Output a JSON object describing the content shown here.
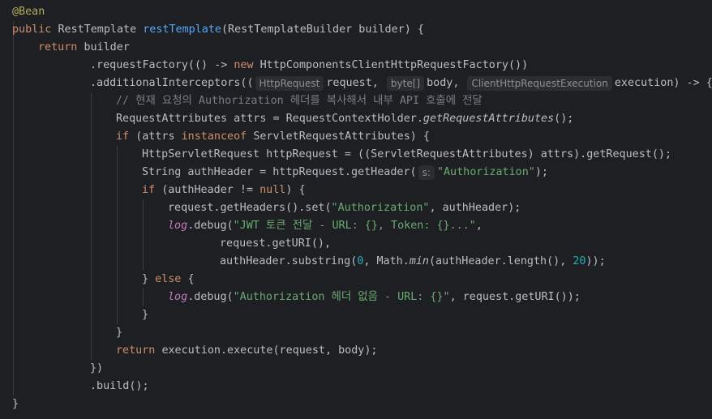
{
  "editor": {
    "language": "java",
    "inlay_hints": [
      "HttpRequest",
      "byte[]",
      "ClientHttpRequestExecution",
      "s:"
    ],
    "colors": {
      "background": "#1e1f22",
      "default": "#bcbec4",
      "keyword": "#cf8e6d",
      "annotation": "#b3ae60",
      "method_declaration": "#56a8f5",
      "string": "#6aab73",
      "number": "#2aacb8",
      "comment": "#7a7e85",
      "static_field": "#c77dbb",
      "inlay_hint_bg": "#2b2d30",
      "inlay_hint_text": "#8c8f94"
    },
    "lines": [
      {
        "indent": 0,
        "tokens": [
          {
            "t": "@Bean",
            "c": "ann"
          }
        ]
      },
      {
        "indent": 0,
        "tokens": [
          {
            "t": "public ",
            "c": "kw"
          },
          {
            "t": "RestTemplate ",
            "c": "def"
          },
          {
            "t": "restTemplate",
            "c": "fn"
          },
          {
            "t": "(RestTemplateBuilder builder) {",
            "c": "def"
          }
        ]
      },
      {
        "indent": 1,
        "tokens": [
          {
            "t": "return ",
            "c": "kw"
          },
          {
            "t": "builder",
            "c": "def"
          }
        ]
      },
      {
        "indent": 3,
        "tokens": [
          {
            "t": ".requestFactory(() -> ",
            "c": "def"
          },
          {
            "t": "new ",
            "c": "kw"
          },
          {
            "t": "HttpComponentsClientHttpRequestFactory())",
            "c": "def"
          }
        ]
      },
      {
        "indent": 3,
        "tokens": [
          {
            "t": ".additionalInterceptors((",
            "c": "def"
          },
          {
            "t": "HttpRequest",
            "c": "hint"
          },
          {
            "t": "request, ",
            "c": "def"
          },
          {
            "t": "byte[]",
            "c": "hint"
          },
          {
            "t": "body, ",
            "c": "def"
          },
          {
            "t": "ClientHttpRequestExecution",
            "c": "hint"
          },
          {
            "t": "execution) -> {",
            "c": "def"
          }
        ]
      },
      {
        "indent": 4,
        "tokens": [
          {
            "t": "// 현재 요청의 Authorization 헤더를 복사해서 내부 API 호출에 전달",
            "c": "cmt"
          }
        ]
      },
      {
        "indent": 4,
        "tokens": [
          {
            "t": "RequestAttributes attrs = RequestContextHolder.",
            "c": "def"
          },
          {
            "t": "getRequestAttributes",
            "c": "def ital"
          },
          {
            "t": "();",
            "c": "def"
          }
        ]
      },
      {
        "indent": 4,
        "tokens": [
          {
            "t": "if ",
            "c": "kw"
          },
          {
            "t": "(attrs ",
            "c": "def"
          },
          {
            "t": "instanceof ",
            "c": "kw"
          },
          {
            "t": "ServletRequestAttributes) {",
            "c": "def"
          }
        ]
      },
      {
        "indent": 5,
        "tokens": [
          {
            "t": "HttpServletRequest httpRequest = ((ServletRequestAttributes) attrs).getRequest();",
            "c": "def"
          }
        ]
      },
      {
        "indent": 5,
        "tokens": [
          {
            "t": "String authHeader = httpRequest.getHeader(",
            "c": "def"
          },
          {
            "t": "s:",
            "c": "hint"
          },
          {
            "t": "\"Authorization\"",
            "c": "str"
          },
          {
            "t": ");",
            "c": "def"
          }
        ]
      },
      {
        "indent": 5,
        "tokens": [
          {
            "t": "if ",
            "c": "kw"
          },
          {
            "t": "(authHeader != ",
            "c": "def"
          },
          {
            "t": "null",
            "c": "kw"
          },
          {
            "t": ") {",
            "c": "def"
          }
        ]
      },
      {
        "indent": 6,
        "tokens": [
          {
            "t": "request.getHeaders().set(",
            "c": "def"
          },
          {
            "t": "\"Authorization\"",
            "c": "str"
          },
          {
            "t": ", authHeader);",
            "c": "def"
          }
        ]
      },
      {
        "indent": 6,
        "tokens": [
          {
            "t": "log",
            "c": "field ital"
          },
          {
            "t": ".debug(",
            "c": "def"
          },
          {
            "t": "\"JWT 토큰 전달 - URL: {}, Token: {}...\"",
            "c": "str"
          },
          {
            "t": ",",
            "c": "def"
          }
        ]
      },
      {
        "indent": 8,
        "tokens": [
          {
            "t": "request.getURI(),",
            "c": "def"
          }
        ]
      },
      {
        "indent": 8,
        "tokens": [
          {
            "t": "authHeader.substring(",
            "c": "def"
          },
          {
            "t": "0",
            "c": "num"
          },
          {
            "t": ", Math.",
            "c": "def"
          },
          {
            "t": "min",
            "c": "def ital"
          },
          {
            "t": "(authHeader.length(), ",
            "c": "def"
          },
          {
            "t": "20",
            "c": "num"
          },
          {
            "t": "));",
            "c": "def"
          }
        ]
      },
      {
        "indent": 5,
        "tokens": [
          {
            "t": "} ",
            "c": "def"
          },
          {
            "t": "else ",
            "c": "kw"
          },
          {
            "t": "{",
            "c": "def"
          }
        ]
      },
      {
        "indent": 6,
        "tokens": [
          {
            "t": "log",
            "c": "field ital"
          },
          {
            "t": ".debug(",
            "c": "def"
          },
          {
            "t": "\"Authorization 헤더 없음 - URL: {}\"",
            "c": "str"
          },
          {
            "t": ", request.getURI());",
            "c": "def"
          }
        ]
      },
      {
        "indent": 5,
        "tokens": [
          {
            "t": "}",
            "c": "def"
          }
        ]
      },
      {
        "indent": 4,
        "tokens": [
          {
            "t": "}",
            "c": "def"
          }
        ]
      },
      {
        "indent": 4,
        "tokens": [
          {
            "t": "return ",
            "c": "kw"
          },
          {
            "t": "execution.execute(request, body);",
            "c": "def"
          }
        ]
      },
      {
        "indent": 3,
        "tokens": [
          {
            "t": "})",
            "c": "def"
          }
        ]
      },
      {
        "indent": 3,
        "tokens": [
          {
            "t": ".build();",
            "c": "def"
          }
        ]
      },
      {
        "indent": 0,
        "tokens": [
          {
            "t": "}",
            "c": "def"
          }
        ]
      }
    ]
  }
}
